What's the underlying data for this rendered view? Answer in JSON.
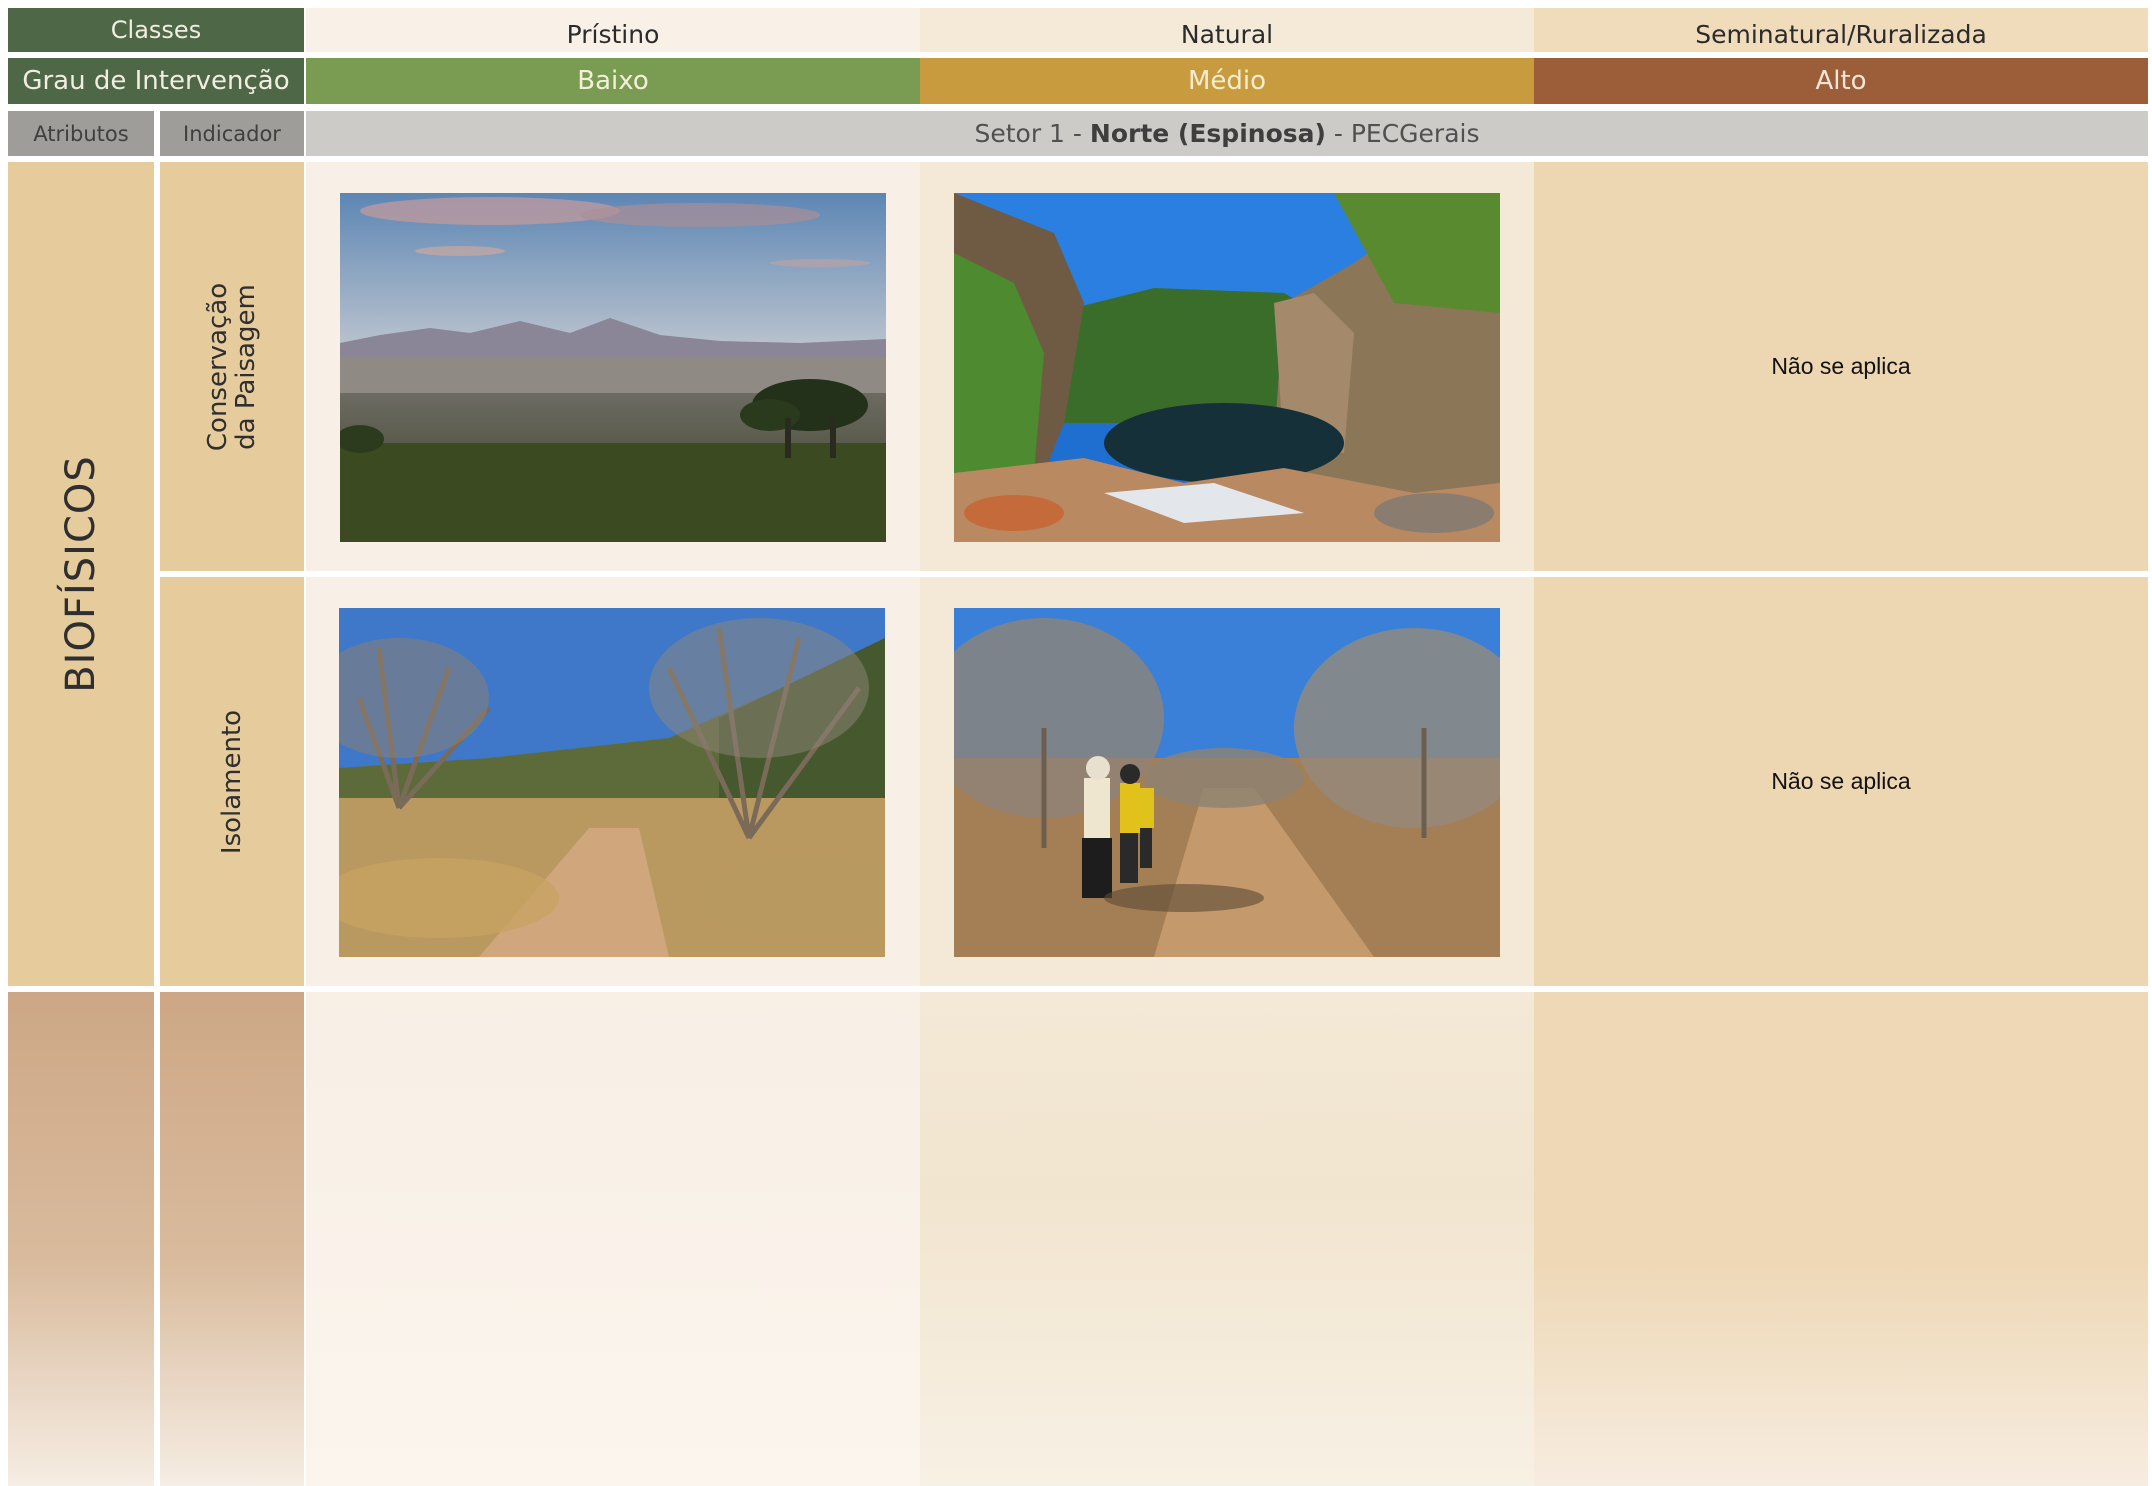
{
  "header": {
    "classes_label": "Classes",
    "classes": [
      "Prístino",
      "Natural",
      "Seminatural/Ruralizada"
    ],
    "grau_label": "Grau de Intervenção",
    "graus": [
      "Baixo",
      "Médio",
      "Alto"
    ],
    "atributos_label": "Atributos",
    "indicador_label": "Indicador",
    "sector": {
      "prefix": "Setor 1 - ",
      "name": "Norte (Espinosa)",
      "suffix": " - PECGerais"
    }
  },
  "attribute": "BIOFÍSICOS",
  "rows": [
    {
      "indicator_line1": "Conservação",
      "indicator_line2": "da Paisagem",
      "photo_pristino": "mountain-landscape-photo",
      "photo_natural": "canyon-waterhole-photo",
      "semi_text": "Não se aplica"
    },
    {
      "indicator_line1": "Isolamento",
      "indicator_line2": "",
      "photo_pristino": "dry-forest-trail-photo",
      "photo_natural": "hikers-dry-forest-photo",
      "semi_text": "Não se aplica"
    }
  ],
  "colors": {
    "header_green": "#4e6747",
    "baixo": "#7a9b52",
    "medio": "#c79b3e",
    "alto": "#9c5d39",
    "indicator_bg": "#e6cc9d"
  }
}
